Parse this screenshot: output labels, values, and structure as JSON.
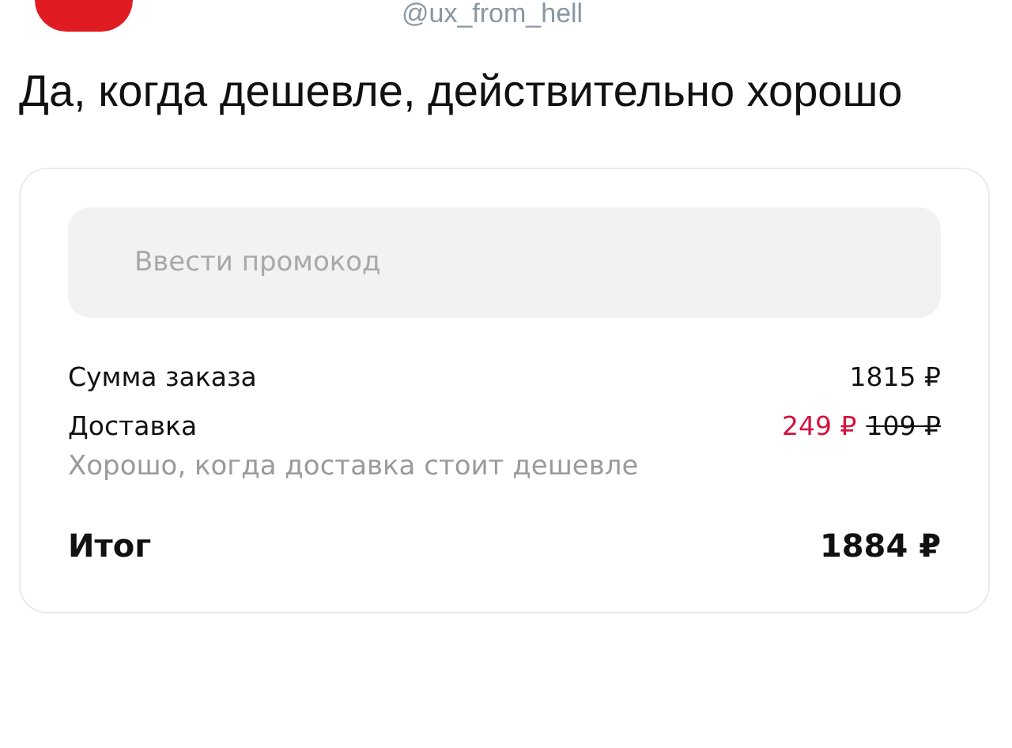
{
  "post": {
    "handle": "@ux_from_hell",
    "text": "Да, когда дешевле, действительно хорошо"
  },
  "order": {
    "promo": {
      "placeholder": "Ввести промокод"
    },
    "rows": [
      {
        "kind": "plain",
        "label": "Сумма заказа",
        "value": "1815 ₽"
      },
      {
        "kind": "discount",
        "label": "Доставка",
        "value": "249 ₽",
        "old_value": "109 ₽",
        "note": "Хорошо, когда доставка стоит дешевле"
      },
      {
        "kind": "total",
        "label": "Итог",
        "value": "1884 ₽"
      }
    ]
  }
}
